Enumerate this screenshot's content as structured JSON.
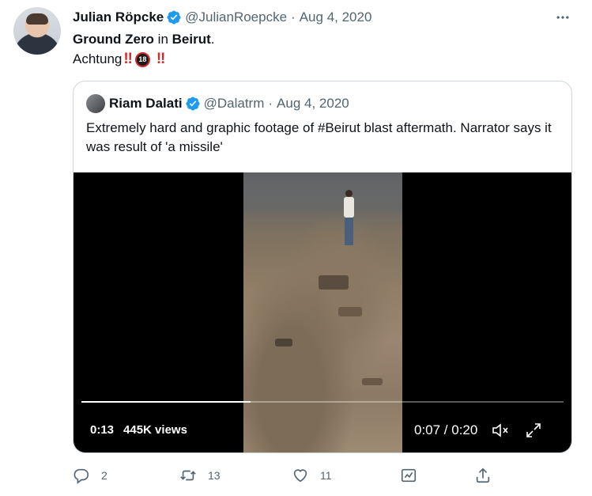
{
  "tweet": {
    "author_name": "Julian Röpcke",
    "author_handle": "@JulianRoepcke",
    "separator": "·",
    "date": "Aug 4, 2020",
    "text_line1_bold1": "Ground Zero",
    "text_line1_mid": " in ",
    "text_line1_bold2": "Beirut",
    "text_line1_end": ".",
    "text_line2": "Achtung",
    "emoji_warning": "‼",
    "emoji_18": "18"
  },
  "quote": {
    "author_name": "Riam Dalati",
    "author_handle": "@Dalatrm",
    "separator": "·",
    "date": "Aug 4, 2020",
    "text": "Extremely hard and graphic footage of #Beirut blast aftermath. Narrator says it was result of 'a missile'",
    "video": {
      "elapsed": "0:13",
      "views": "445K views",
      "time_display": "0:07 / 0:20",
      "progress": 0.35
    }
  },
  "actions": {
    "reply_count": "2",
    "retweet_count": "13",
    "like_count": "11"
  },
  "colors": {
    "verified": "#1d9bf0",
    "muted_text": "#536471",
    "border": "#cfd9de"
  },
  "icons": [
    "verified-icon",
    "more-icon",
    "mute-icon",
    "fullscreen-icon",
    "reply-icon",
    "retweet-icon",
    "like-icon",
    "analytics-icon",
    "share-icon"
  ]
}
